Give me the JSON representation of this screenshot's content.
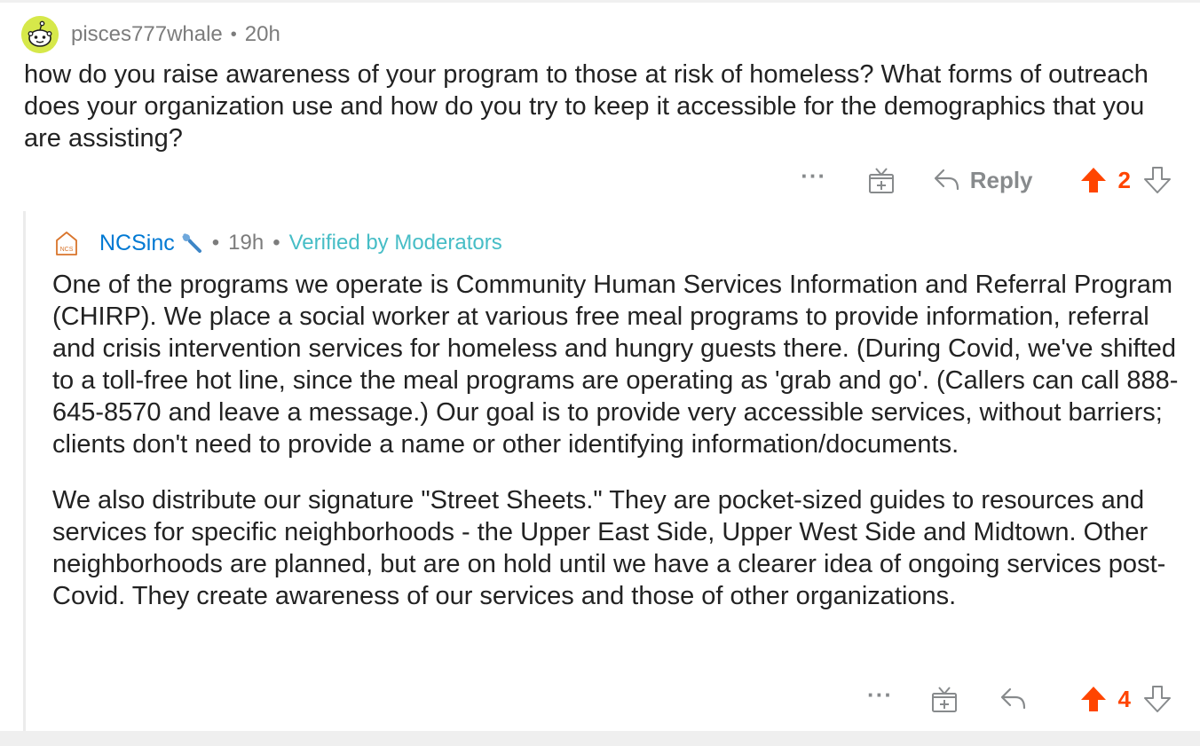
{
  "parent": {
    "username": "pisces777whale",
    "separator": "•",
    "time": "20h",
    "body": "how do you raise awareness of your program to those at risk of homeless? What forms of outreach does your organization use and how do you try to keep it accessible for the demographics that you are assisting?",
    "actions": {
      "more_label": "···",
      "reply_label": "Reply",
      "score": "2"
    }
  },
  "reply": {
    "username": "NCSinc",
    "separator": "•",
    "time": "19h",
    "separator2": "•",
    "verified_label": "Verified by Moderators",
    "logo_text": "NCS",
    "paragraphs": [
      "One of the programs we operate is Community Human Services Information and Referral Program (CHIRP). We place a social worker at various free meal programs to provide information, referral and crisis intervention services for homeless and hungry guests there. (During Covid, we've shifted to a toll-free hot line, since the meal programs are operating as 'grab and go'. (Callers can call 888-645-8570 and leave a message.)  Our goal is to provide very accessible services, without barriers; clients don't need to provide a name or other identifying information/documents.",
      "We also distribute our signature \"Street Sheets.\" They are pocket-sized guides to resources and services for specific neighborhoods - the Upper East Side, Upper West Side and Midtown. Other neighborhoods are planned, but are on hold until we have a clearer idea of ongoing services post-Covid.  They create awareness of our services and those of other organizations."
    ],
    "actions": {
      "more_label": "···",
      "score": "4"
    }
  },
  "colors": {
    "upvote_active": "#ff4500",
    "username_link": "#0079d3",
    "verified": "#46bdc6",
    "meta_gray": "#7c7c7c"
  },
  "icons": [
    "avatar-icon",
    "more-icon",
    "award-icon",
    "reply-arrow-icon",
    "upvote-icon",
    "downvote-icon",
    "wrench-icon",
    "ncs-logo-icon"
  ]
}
